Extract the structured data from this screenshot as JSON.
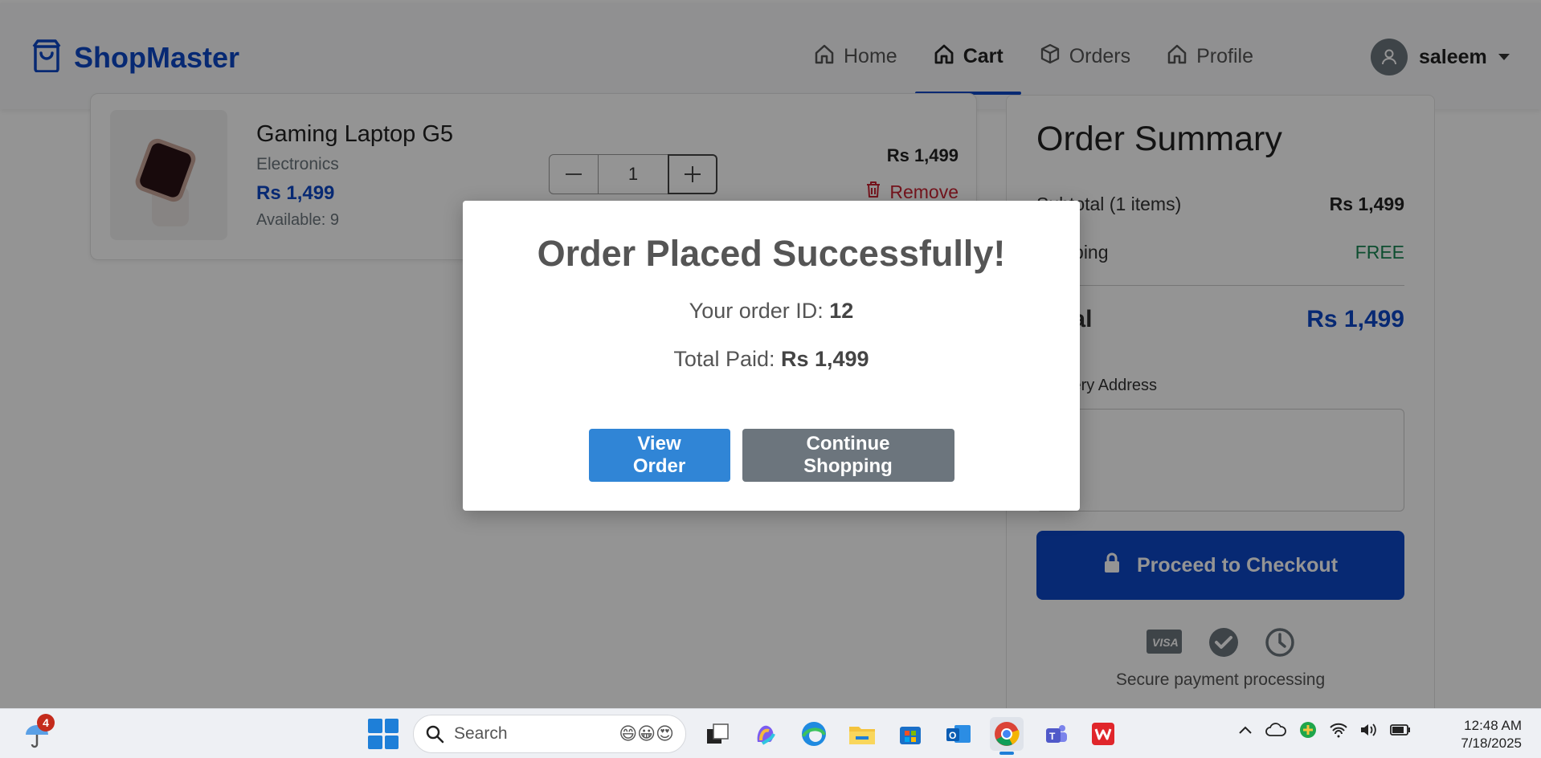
{
  "navbar": {
    "brand": "ShopMaster",
    "links": [
      {
        "label": "Home",
        "icon": "home-icon"
      },
      {
        "label": "Cart",
        "icon": "home-icon",
        "active": true
      },
      {
        "label": "Orders",
        "icon": "box-icon"
      },
      {
        "label": "Profile",
        "icon": "home-icon"
      }
    ],
    "user": "saleem"
  },
  "cart": {
    "item": {
      "name": "Gaming Laptop G5",
      "category": "Electronics",
      "price": "Rs 1,499",
      "available": "Available: 9",
      "quantity": "1",
      "line_total": "Rs 1,499",
      "remove_label": "Remove"
    }
  },
  "summary": {
    "title": "Order Summary",
    "subtotal_label": "Subtotal (1 items)",
    "subtotal_value": "Rs 1,499",
    "shipping_label": "Shipping",
    "shipping_value": "FREE",
    "total_label": "Total",
    "total_value": "Rs 1,499",
    "address_label": "Delivery Address",
    "address_value": "",
    "checkout_label": "Proceed to Checkout",
    "secure_text": "Secure payment processing"
  },
  "modal": {
    "title": "Order Placed Successfully!",
    "order_id_label": "Your order ID: ",
    "order_id": "12",
    "total_label": "Total Paid: ",
    "total_value": "Rs 1,499",
    "view_order": "View Order",
    "continue_shopping": "Continue Shopping"
  },
  "taskbar": {
    "notification_count": "4",
    "search_placeholder": "Search",
    "time": "12:48 AM",
    "date": "7/18/2025"
  },
  "colors": {
    "brand": "#0d47c6",
    "primary_button": "#3085d6",
    "secondary_button": "#6c757d",
    "danger": "#c82333",
    "success": "#198754"
  }
}
